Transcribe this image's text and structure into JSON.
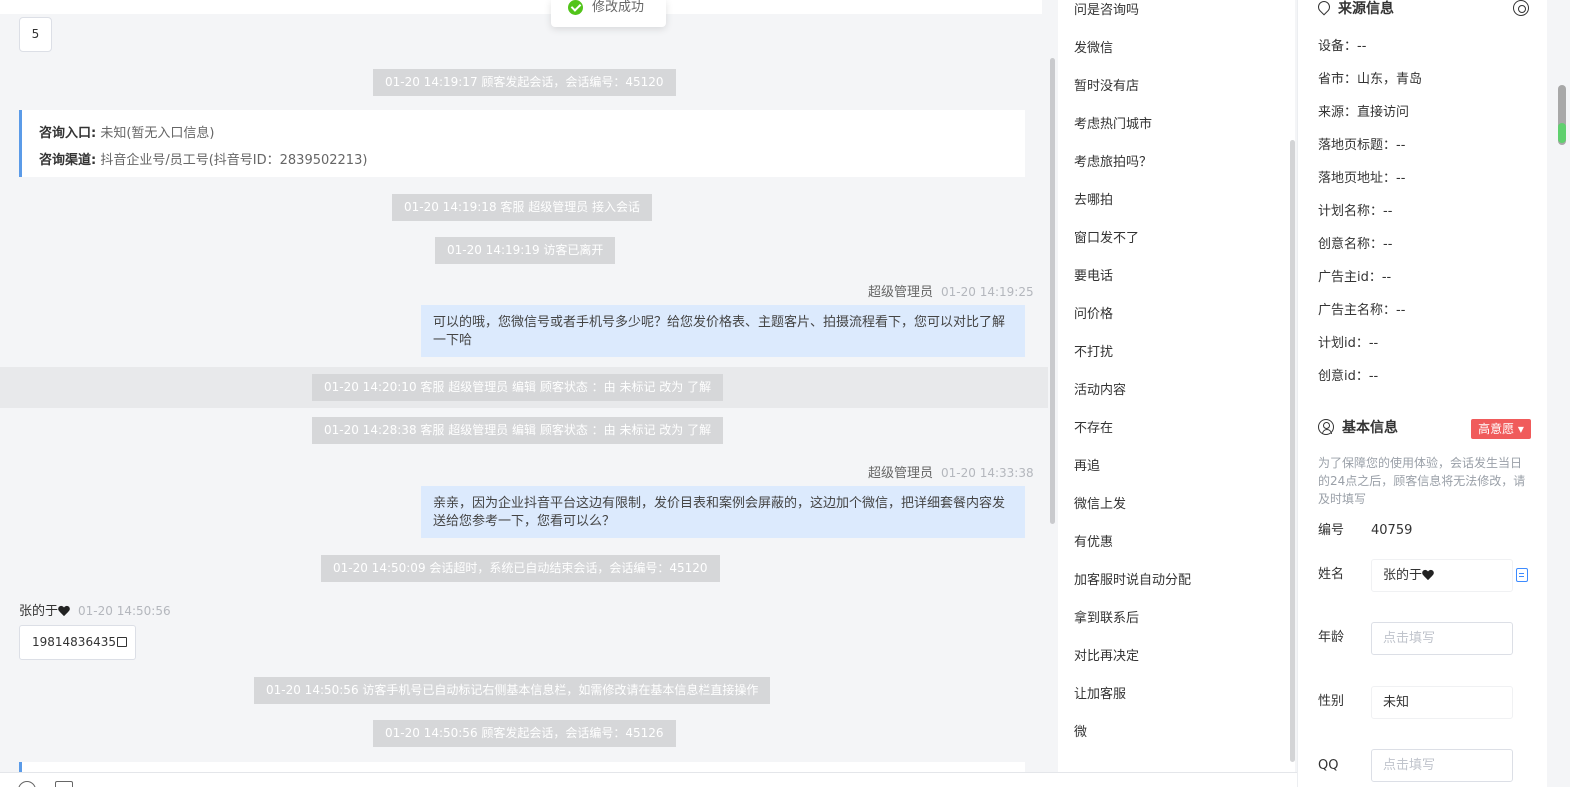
{
  "toast": {
    "text": "修改成功"
  },
  "chat": {
    "number_box": "5",
    "system_messages": [
      "01-20 14:19:17 顾客发起会话，会话编号：45120",
      "01-20 14:19:18 客服 超级管理员 接入会话",
      "01-20 14:19:19 访客已离开",
      "01-20 14:20:10 客服 超级管理员 编辑 顾客状态 ：由 未标记 改为 了解",
      "01-20 14:28:38 客服 超级管理员 编辑 顾客状态 ：由 未标记 改为 了解",
      "01-20 14:50:09 会话超时，系统已自动结束会话，会话编号：45120",
      "01-20 14:50:56 访客手机号已自动标记右侧基本信息栏，如需修改请在基本信息栏直接操作",
      "01-20 14:50:56 顾客发起会话，会话编号：45126"
    ],
    "info_card": {
      "entry_label": "咨询入口:",
      "entry_value": "未知(暂无入口信息)",
      "channel_label": "咨询渠道:",
      "channel_value": "抖音企业号/员工号(抖音号ID：2839502213)"
    },
    "agent_messages": [
      {
        "sender": "超级管理员",
        "time": "01-20 14:19:25",
        "text": "可以的哦，您微信号或者手机号多少呢？给您发价格表、主题客片、拍摄流程看下，您可以对比了解一下哈"
      },
      {
        "sender": "超级管理员",
        "time": "01-20 14:33:38",
        "text": "亲亲，因为企业抖音平台这边有限制，发价目表和案例会屏蔽的，这边加个微信，把详细套餐内容发送给您参考一下，您看可以么？"
      }
    ],
    "visitor_message": {
      "sender": "张的于",
      "time": "01-20 14:50:56",
      "text": "19814836435"
    }
  },
  "quick_replies": [
    "问是咨询吗",
    "发微信",
    "暂时没有店",
    "考虑热门城市",
    "考虑旅拍吗？",
    "去哪拍",
    "窗口发不了",
    "要电话",
    "问价格",
    "不打扰",
    "活动内容",
    "不存在",
    "再追",
    "微信上发",
    "有优惠",
    "加客服时说自动分配",
    "拿到联系后",
    "对比再决定",
    "让加客服",
    "微"
  ],
  "source_info": {
    "title": "来源信息",
    "rows": [
      "设备：--",
      "省市：山东，青岛",
      "来源：直接访问",
      "落地页标题：--",
      "落地页地址：--",
      "计划名称：--",
      "创意名称：--",
      "广告主id：--",
      "广告主名称：--",
      "计划id：--",
      "创意id：--"
    ]
  },
  "basic_info": {
    "title": "基本信息",
    "badge": "高意愿 ▾",
    "note": "为了保障您的使用体验，会话发生当日的24点之后，顾客信息将无法修改，请及时填写",
    "id_label": "编号",
    "id_value": "40759",
    "name_label": "姓名",
    "name_value": "张的于",
    "age_label": "年龄",
    "age_placeholder": "点击填写",
    "gender_label": "性别",
    "gender_value": "未知",
    "qq_label": "QQ",
    "qq_placeholder": "点击填写"
  },
  "colors": {
    "accent": "#5b9be8",
    "bubble": "#dceafd",
    "badge": "#f05b5b",
    "success": "#52c41a"
  },
  "icons": [
    "location-icon",
    "settings-icon",
    "user-circle-icon",
    "copy-icon",
    "success-check-icon",
    "heart-icon"
  ]
}
